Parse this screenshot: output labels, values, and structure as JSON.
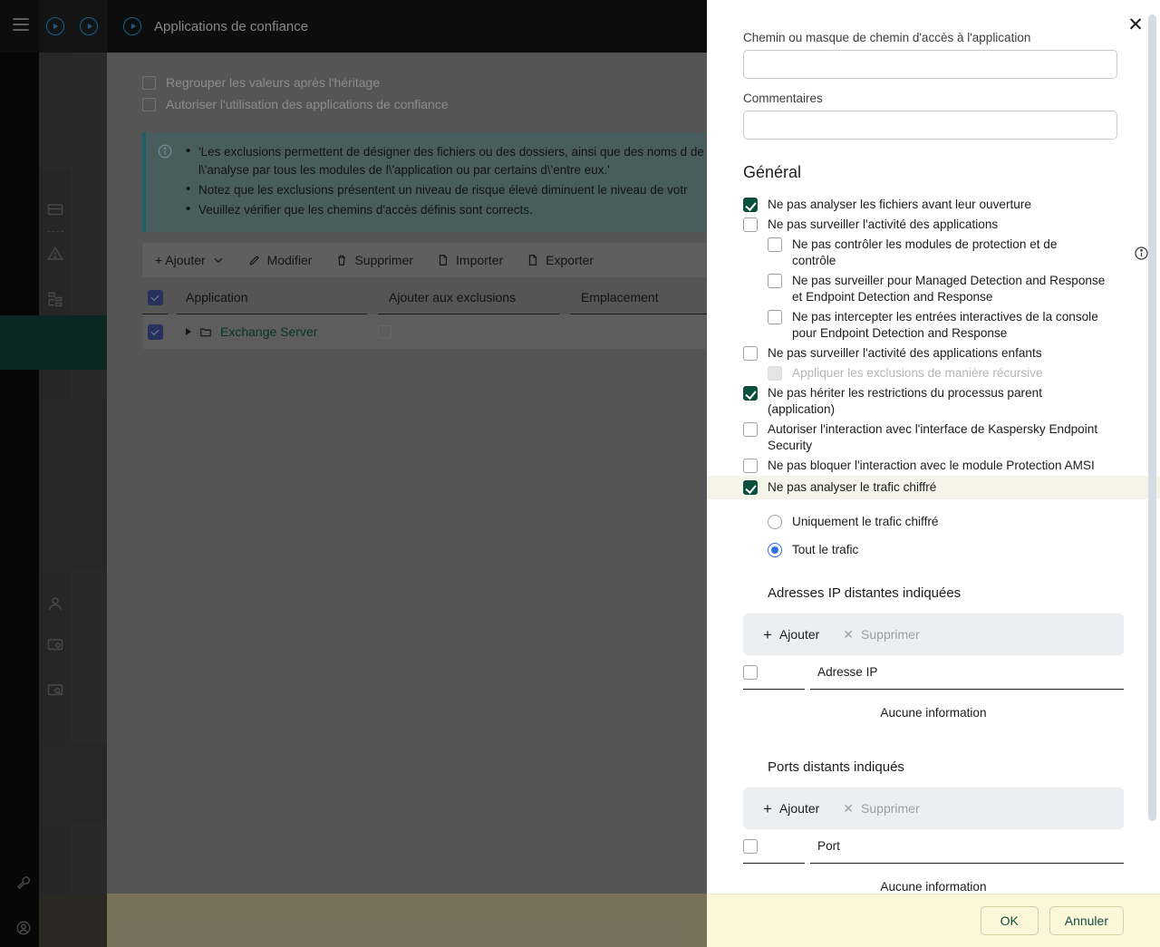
{
  "background": {
    "topbar": {
      "title": "Applications de confiance"
    },
    "options": [
      {
        "label": "Regrouper les valeurs après l'héritage",
        "checked": false
      },
      {
        "label": "Autoriser l'utilisation des applications de confiance",
        "checked": false
      }
    ],
    "info_box": {
      "icon": "info-circle-icon",
      "bullets": [
        "'Les exclusions permettent de désigner des fichiers ou des dossiers, ainsi que des noms d de l\\'analyse par tous les modules de l\\'application ou par certains d\\'entre eux.'",
        "Notez que les exclusions présentent un niveau de risque élevé diminuent le niveau de votr",
        "Veuillez vérifier que les chemins d'accès définis sont corrects."
      ]
    },
    "toolbar": [
      {
        "label": "+ Ajouter",
        "icon": "chevron-down-icon"
      },
      {
        "label": "Modifier",
        "icon": "pencil-icon"
      },
      {
        "label": "Supprimer",
        "icon": "trash-icon"
      },
      {
        "label": "Importer",
        "icon": "import-icon"
      },
      {
        "label": "Exporter",
        "icon": "export-icon"
      }
    ],
    "table": {
      "columns": [
        "Application",
        "Ajouter aux exclusions",
        "Emplacement"
      ],
      "rows": [
        {
          "application": "Exchange Server",
          "add_to_exclusions": false,
          "location": "",
          "selected": true
        }
      ]
    },
    "sidebar_icons": [
      "monitor-icon",
      "warning-triangle-icon",
      "list-icon",
      "user-icon",
      "monitor-gear-icon",
      "monitor-search-icon",
      "wrench-icon",
      "user-circle-icon"
    ]
  },
  "panel": {
    "close_label": "✕",
    "path_field": {
      "label": "Chemin ou masque de chemin d'accès à l'application",
      "value": "",
      "placeholder": ""
    },
    "comments_field": {
      "label": "Commentaires",
      "value": "",
      "placeholder": ""
    },
    "general": {
      "title": "Général",
      "options": [
        {
          "label": "Ne pas analyser les fichiers avant leur ouverture",
          "checked": true,
          "indent": 0,
          "disabled": false,
          "highlight": false,
          "info": false
        },
        {
          "label": "Ne pas surveiller l'activité des applications",
          "checked": false,
          "indent": 0,
          "disabled": false,
          "highlight": false,
          "info": false
        },
        {
          "label": "Ne pas contrôler les modules de protection et de contrôle",
          "checked": false,
          "indent": 1,
          "disabled": false,
          "highlight": false,
          "info": true
        },
        {
          "label": "Ne pas surveiller pour Managed Detection and Response et Endpoint Detection and Response",
          "checked": false,
          "indent": 1,
          "disabled": false,
          "highlight": false,
          "info": false
        },
        {
          "label": "Ne pas intercepter les entrées interactives de la console pour Endpoint Detection and Response",
          "checked": false,
          "indent": 1,
          "disabled": false,
          "highlight": false,
          "info": false
        },
        {
          "label": "Ne pas surveiller l'activité des applications enfants",
          "checked": false,
          "indent": 0,
          "disabled": false,
          "highlight": false,
          "info": false
        },
        {
          "label": "Appliquer les exclusions de manière récursive",
          "checked": false,
          "indent": 1,
          "disabled": true,
          "highlight": false,
          "info": false
        },
        {
          "label": "Ne pas hériter les restrictions du processus parent (application)",
          "checked": true,
          "indent": 0,
          "disabled": false,
          "highlight": false,
          "info": false
        },
        {
          "label": "Autoriser l'interaction avec l'interface de Kaspersky Endpoint Security",
          "checked": false,
          "indent": 0,
          "disabled": false,
          "highlight": false,
          "info": false
        },
        {
          "label": "Ne pas bloquer l'interaction avec le module Protection AMSI",
          "checked": false,
          "indent": 0,
          "disabled": false,
          "highlight": false,
          "info": false
        },
        {
          "label": "Ne pas analyser le trafic chiffré",
          "checked": true,
          "indent": 0,
          "disabled": false,
          "highlight": true,
          "info": false
        }
      ],
      "traffic_radios": [
        {
          "label": "Uniquement le trafic chiffré",
          "selected": false
        },
        {
          "label": "Tout le trafic",
          "selected": true
        }
      ]
    },
    "ip_section": {
      "title": "Adresses IP distantes indiquées",
      "add_label": "Ajouter",
      "delete_label": "Supprimer",
      "column": "Adresse IP",
      "empty_text": "Aucune information"
    },
    "ports_section": {
      "title": "Ports distants indiqués",
      "add_label": "Ajouter",
      "delete_label": "Supprimer",
      "column": "Port",
      "empty_text": "Aucune information"
    },
    "footer": {
      "ok_label": "OK",
      "cancel_label": "Annuler"
    }
  },
  "colors": {
    "checkbox_checked": "#0c4f3f",
    "radio_selected": "#2f6fed",
    "highlight_row": "#f4f4e8",
    "footer_bg": "#fdf7d9",
    "accent_blue": "#1f8fd6"
  }
}
